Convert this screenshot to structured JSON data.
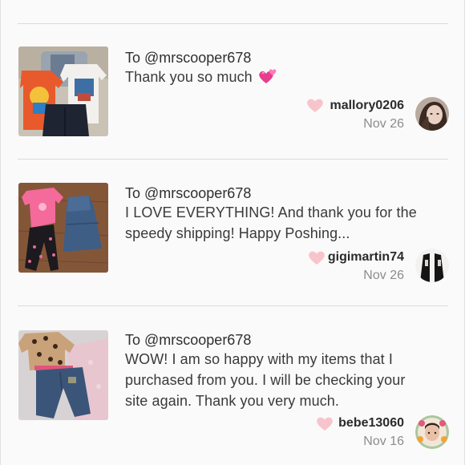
{
  "reviews": [
    {
      "to": "To @mrscooper678",
      "message": "Thank you so much",
      "emoji_icon": "two-hearts-icon",
      "username": "mallory0206",
      "date": "Nov 26",
      "heart_color": "#f7c4cc"
    },
    {
      "to": "To @mrscooper678",
      "message_line1": "I LOVE EVERYTHING! And thank you for the",
      "message_line2": "speedy shipping! Happy Poshing...",
      "username": "gigimartin74",
      "date": "Nov 26",
      "heart_color": "#f7c4cc"
    },
    {
      "to": "To @mrscooper678",
      "message_line1": "WOW! I am so happy with my items that I",
      "message_line2": "purchased from you. I will be checking your",
      "message_line3": "site again. Thank you very much.",
      "username": "bebe13060",
      "date": "Nov 16",
      "heart_color": "#f7c4cc"
    }
  ]
}
